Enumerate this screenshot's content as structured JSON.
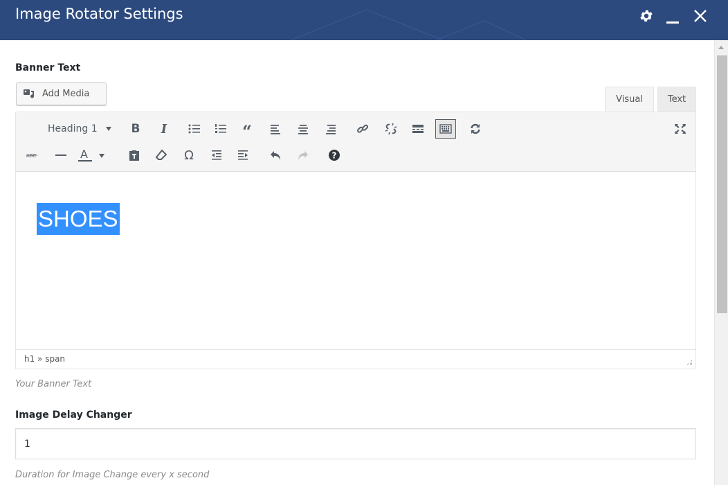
{
  "window": {
    "title": "Image Rotator Settings",
    "bar_color": "#2c4a7e",
    "controls": [
      "gear-icon",
      "minimize-icon",
      "close-icon"
    ]
  },
  "banner": {
    "label": "Banner Text",
    "add_media_label": "Add Media",
    "tabs": {
      "visual": "Visual",
      "text": "Text"
    },
    "toolbar": {
      "format_value": "Heading 1",
      "row1_icons": [
        "bold-icon",
        "italic-icon",
        "bullet-list-icon",
        "numbered-list-icon",
        "blockquote-icon",
        "align-left-icon",
        "align-center-icon",
        "align-right-icon",
        "link-icon",
        "unlink-icon",
        "read-more-icon",
        "toolbar-toggle-icon",
        "refresh-icon",
        "fullscreen-icon"
      ],
      "row2_icons": [
        "strikethrough-icon",
        "horizontal-line-icon",
        "text-color-icon",
        "paste-text-icon",
        "clear-formatting-icon",
        "special-character-icon",
        "outdent-icon",
        "indent-icon",
        "undo-icon",
        "redo-icon",
        "help-icon"
      ]
    },
    "content": "SHOES",
    "selection_color": "#3390ff",
    "status_path": "h1 » span",
    "description": "Your Banner Text"
  },
  "delay": {
    "label": "Image Delay Changer",
    "value": "1",
    "description": "Duration for Image Change every x second"
  }
}
